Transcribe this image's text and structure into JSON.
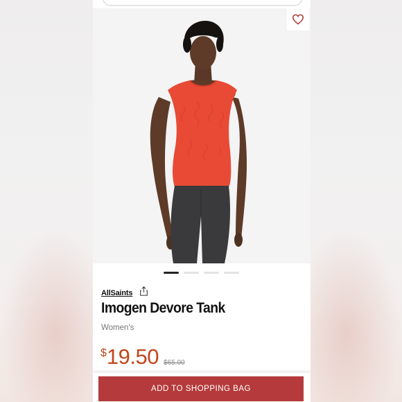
{
  "product": {
    "brand": "AllSaints",
    "title": "Imogen Devore Tank",
    "category": "Women's",
    "price_currency": "$",
    "price": "19.50",
    "original_price": "$65.00"
  },
  "gallery": {
    "image_count": 4,
    "active_index": 0
  },
  "actions": {
    "add_to_bag": "ADD TO SHOPPING BAG"
  },
  "colors": {
    "accent": "#b53a3b",
    "price": "#c2461c",
    "tank": "#e84a36"
  },
  "icons": {
    "favorite": "heart-icon",
    "share": "share-icon"
  }
}
